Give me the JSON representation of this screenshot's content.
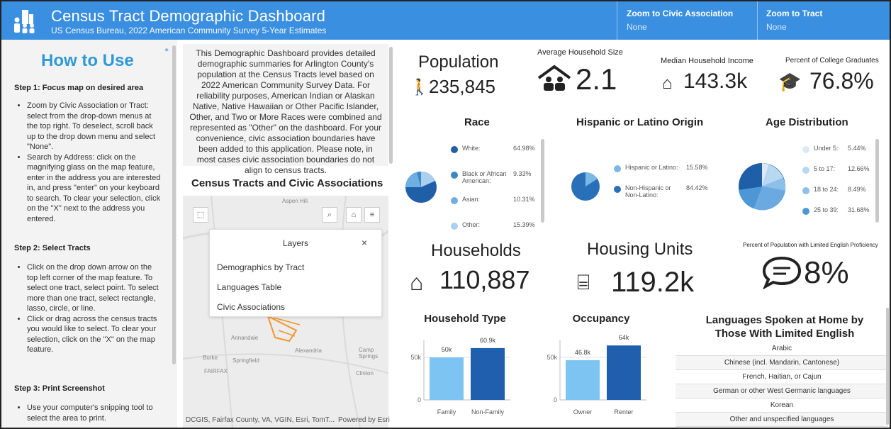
{
  "header": {
    "title": "Census Tract Demographic Dashboard",
    "subtitle": "US Census Bureau, 2022 American Community Survey 5-Year Estimates",
    "zoom_civic_label": "Zoom to Civic Association",
    "zoom_civic_value": "None",
    "zoom_tract_label": "Zoom to Tract",
    "zoom_tract_value": "None",
    "accent": "#3b8fe0"
  },
  "how_to_use": {
    "title": "How to Use",
    "step1": "Step 1: Focus map on desired area",
    "step1_b1": "Zoom by Civic Association or Tract: select from the drop-down menus at the top right. To deselect, scroll back up to the drop down menu and select \"None\".",
    "step1_b2": "Search by Address: click on the magnifying glass on the map feature, enter in the address you are interested in, and press \"enter\" on your keyboard to search. To clear your selection, click on the \"X\" next to the address you entered.",
    "step2": "Step 2: Select Tracts",
    "step2_b1": "Click on the drop down arrow on the top left corner of the map feature. To select one tract, select point. To select more than one tract, select rectangle, lasso, circle, or line.",
    "step2_b2": "Click or drag across the census tracts you would like to select. To clear your selection, click on the \"X\" on the map feature.",
    "step3": "Step 3: Print Screenshot",
    "step3_b1": "Use your computer's snipping tool to select the area to print."
  },
  "intro": "This Demographic Dashboard provides detailed demographic summaries for Arlington County's population at the Census Tracts level based on 2022 American Community Survey Data.  For reliability purposes, American Indian or Alaskan Native, Native Hawaiian or Other Pacific Islander, Other, and Two or More Races were combined and represented as \"Other\" on the dashboard. For your convenience, civic association boundaries have been added to this application. Please note, in most cases civic association boundaries do not align to census tracts.",
  "map": {
    "title": "Census Tracts and Civic Associations",
    "place_aspen": "Aspen Hill",
    "place_annandale": "Annandale",
    "place_alexandria": "Alexandria",
    "place_burke": "Burke",
    "place_springfield": "Springfield",
    "place_fairfax": "FAIRFAX",
    "place_camp": "Camp Springs",
    "place_clinton": "Clinton",
    "attribution": "DCGIS, Fairfax County, VA, VGIN, Esri, TomT...",
    "powered": "Powered by Esri",
    "layers_title": "Layers",
    "layers_close": "×",
    "layers": [
      "Demographics by Tract",
      "Languages Table",
      "Civic Associations"
    ]
  },
  "stats": {
    "population_label": "Population",
    "population_value": "235,845",
    "avg_hh_label": "Average Household Size",
    "avg_hh_value": "2.1",
    "income_label": "Median Household Income",
    "income_value": "143.3k",
    "college_label": "Percent of College Graduates",
    "college_value": "76.8%",
    "households_label": "Households",
    "households_value": "110,887",
    "housing_label": "Housing Units",
    "housing_value": "119.2k",
    "english_label": "Percent of Population with Limited English Proficiency",
    "english_value": "8%"
  },
  "race": {
    "title": "Race",
    "items": [
      {
        "label": "White:",
        "value": "64.98%",
        "color": "#1f5fa8"
      },
      {
        "label": "Black or African American:",
        "value": "9.33%",
        "color": "#3d86c8"
      },
      {
        "label": "Asian:",
        "value": "10.31%",
        "color": "#6faee0"
      },
      {
        "label": "Other:",
        "value": "15.39%",
        "color": "#a9d0ef"
      }
    ]
  },
  "hispanic": {
    "title": "Hispanic or Latino Origin",
    "items": [
      {
        "label": "Hispanic or Latino:",
        "value": "15.58%",
        "color": "#7ab8e6"
      },
      {
        "label": "Non-Hispanic or Non-Latino:",
        "value": "84.42%",
        "color": "#2a70b8"
      }
    ]
  },
  "age": {
    "title": "Age Distribution",
    "items": [
      {
        "label": "Under 5:",
        "value": "5.44%",
        "color": "#dde9f7"
      },
      {
        "label": "5 to 17:",
        "value": "12.66%",
        "color": "#b8d7f1"
      },
      {
        "label": "18 to 24:",
        "value": "8.49%",
        "color": "#8cc0e9"
      },
      {
        "label": "25 to 39:",
        "value": "31.68%",
        "color": "#4d97d6"
      }
    ]
  },
  "chart_data": [
    {
      "type": "bar",
      "title": "Household Type",
      "categories": [
        "Family",
        "Non-Family"
      ],
      "values": [
        50,
        60.9
      ],
      "value_labels": [
        "50k",
        "60.9k"
      ],
      "ytick": "50k",
      "ytick0": "0",
      "colors": [
        "#7ec4f2",
        "#1f5fae"
      ],
      "ylim": [
        0,
        70
      ]
    },
    {
      "type": "bar",
      "title": "Occupancy",
      "categories": [
        "Owner",
        "Renter"
      ],
      "values": [
        46.8,
        64
      ],
      "value_labels": [
        "46.8k",
        "64k"
      ],
      "ytick": "50k",
      "ytick0": "0",
      "colors": [
        "#7ec4f2",
        "#1f5fae"
      ],
      "ylim": [
        0,
        70
      ]
    }
  ],
  "languages": {
    "title": "Languages Spoken at Home by Those With Limited English",
    "items": [
      "Arabic",
      "Chinese (incl. Mandarin, Cantonese)",
      "French, Haitian, or Cajun",
      "German or other West Germanic languages",
      "Korean",
      "Other and unspecified languages"
    ]
  }
}
